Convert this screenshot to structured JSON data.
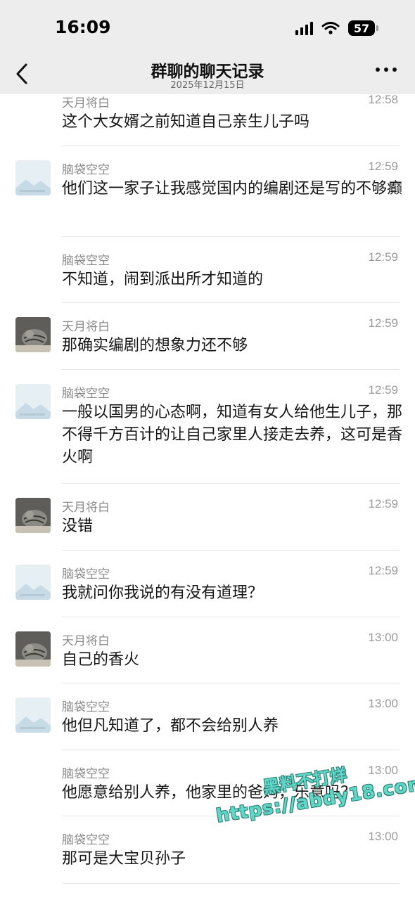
{
  "status_bar": {
    "time": "16:09",
    "battery": "57"
  },
  "nav": {
    "title": "群聊的聊天记录",
    "subtitle": "2025年12月15日"
  },
  "messages": [
    {
      "sender": "天月将白",
      "time": "12:58",
      "text": "这个大女婿之前知道自己亲生儿子吗",
      "avatar": "none"
    },
    {
      "sender": "脑袋空空",
      "time": "12:59",
      "text": "他们这一家子让我感觉国内的编剧还是写的不够癫",
      "avatar": "placeholder"
    },
    {
      "sender": "脑袋空空",
      "time": "12:59",
      "text": "不知道，闹到派出所才知道的",
      "avatar": "none"
    },
    {
      "sender": "天月将白",
      "time": "12:59",
      "text": "那确实编剧的想象力还不够",
      "avatar": "cat"
    },
    {
      "sender": "脑袋空空",
      "time": "12:59",
      "text": "一般以国男的心态啊，知道有女人给他生儿子，那不得千方百计的让自己家里人接走去养，这可是香火啊",
      "avatar": "placeholder"
    },
    {
      "sender": "天月将白",
      "time": "12:59",
      "text": "没错",
      "avatar": "cat"
    },
    {
      "sender": "脑袋空空",
      "time": "12:59",
      "text": "我就问你我说的有没有道理？",
      "avatar": "placeholder"
    },
    {
      "sender": "天月将白",
      "time": "13:00",
      "text": "自己的香火",
      "avatar": "cat"
    },
    {
      "sender": "脑袋空空",
      "time": "13:00",
      "text": "他但凡知道了，都不会给别人养",
      "avatar": "placeholder"
    },
    {
      "sender": "脑袋空空",
      "time": "13:00",
      "text": "他愿意给别人养，他家里的爸妈，乐意吗？",
      "avatar": "none"
    },
    {
      "sender": "脑袋空空",
      "time": "13:00",
      "text": "那可是大宝贝孙子",
      "avatar": "none"
    }
  ],
  "watermark": {
    "line1": "黑料不打烊",
    "line2": "https://abdy18.com"
  }
}
